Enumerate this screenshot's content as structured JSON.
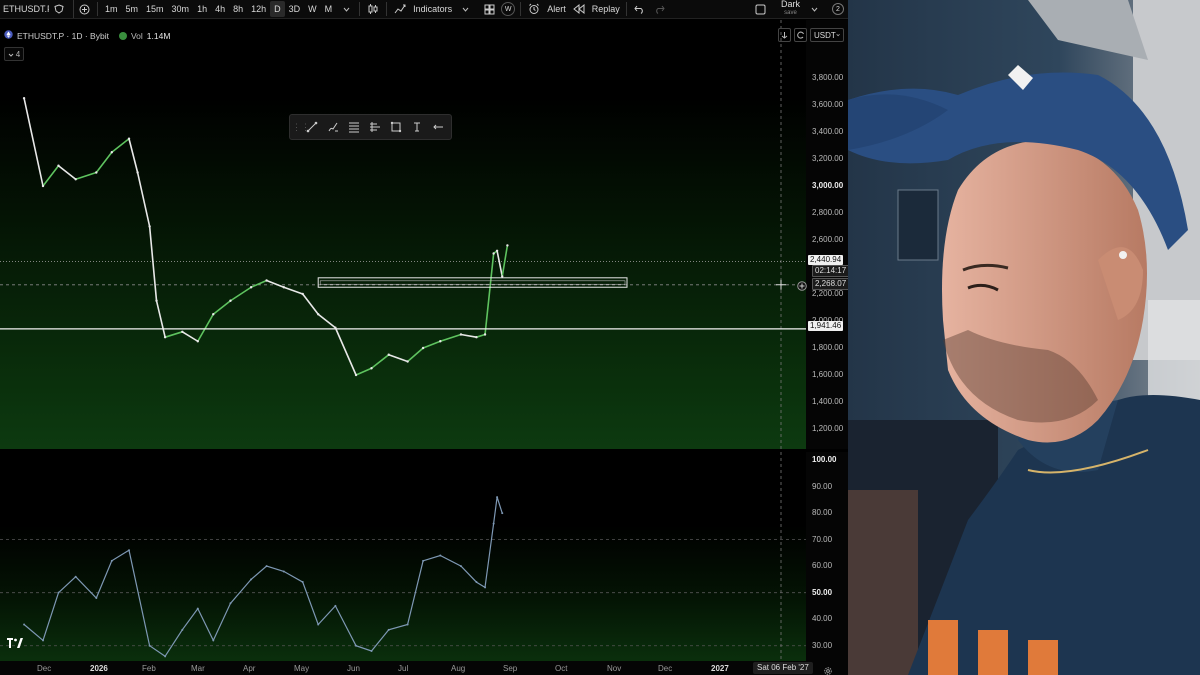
{
  "toolbar": {
    "symbol": "ETHUSDT.P",
    "timeframes": [
      {
        "label": "1m",
        "active": false
      },
      {
        "label": "5m",
        "active": false
      },
      {
        "label": "15m",
        "active": false
      },
      {
        "label": "30m",
        "active": false
      },
      {
        "label": "1h",
        "active": false
      },
      {
        "label": "4h",
        "active": false
      },
      {
        "label": "8h",
        "active": false
      },
      {
        "label": "12h",
        "active": false
      },
      {
        "label": "D",
        "active": true
      },
      {
        "label": "3D",
        "active": false
      },
      {
        "label": "W",
        "active": false
      },
      {
        "label": "M",
        "active": false
      }
    ],
    "indicators_label": "Indicators",
    "watchlist_badge": "W",
    "alert_label": "Alert",
    "replay_label": "Replay",
    "layout_name": "Dark",
    "layout_sub": "save",
    "layout_count": "2"
  },
  "legend": {
    "title": "ETHUSDT.P · 1D · Bybit",
    "vol_label": "Vol",
    "vol_value": "1.14M",
    "collapse_count": "4"
  },
  "currency": "USDT",
  "price_scale": [
    "3,800.00",
    "3,600.00",
    "3,400.00",
    "3,200.00",
    "3,000.00",
    "2,800.00",
    "2,600.00",
    "2,200.00",
    "2,000.00",
    "1,800.00",
    "1,600.00",
    "1,400.00",
    "1,200.00"
  ],
  "price_tags": {
    "last_price": "2,440.94",
    "countdown": "02:14:17",
    "cursor_price": "2,268.07",
    "level": "1,941.46"
  },
  "osc_scale": [
    "100.00",
    "90.00",
    "80.00",
    "70.00",
    "60.00",
    "50.00",
    "40.00",
    "30.00"
  ],
  "time_axis": [
    {
      "label": "Dec",
      "bold": false
    },
    {
      "label": "2026",
      "bold": true
    },
    {
      "label": "Feb",
      "bold": false
    },
    {
      "label": "Mar",
      "bold": false
    },
    {
      "label": "Apr",
      "bold": false
    },
    {
      "label": "May",
      "bold": false
    },
    {
      "label": "Jun",
      "bold": false
    },
    {
      "label": "Jul",
      "bold": false
    },
    {
      "label": "Aug",
      "bold": false
    },
    {
      "label": "Sep",
      "bold": false
    },
    {
      "label": "Oct",
      "bold": false
    },
    {
      "label": "Nov",
      "bold": false
    },
    {
      "label": "Dec",
      "bold": false
    },
    {
      "label": "2027",
      "bold": true
    }
  ],
  "cursor_date": "Sat 06 Feb '27",
  "colors": {
    "up": "#5ec35f",
    "down": "#e8e8e8",
    "osc_line": "#7e98b4",
    "zone": "#ffffff"
  },
  "chart_data": [
    {
      "type": "line",
      "description_series": "ETHUSDT.P daily price (approximate closes)",
      "x": [
        "2025-11-20",
        "2025-12-01",
        "2025-12-10",
        "2025-12-20",
        "2026-01-01",
        "2026-01-10",
        "2026-01-20",
        "2026-01-25",
        "2026-02-01",
        "2026-02-05",
        "2026-02-10",
        "2026-02-20",
        "2026-03-01",
        "2026-03-10",
        "2026-03-20",
        "2026-04-01",
        "2026-04-10",
        "2026-04-20",
        "2026-05-01",
        "2026-05-10",
        "2026-05-20",
        "2026-06-01",
        "2026-06-10",
        "2026-06-20",
        "2026-07-01",
        "2026-07-10",
        "2026-07-20",
        "2026-08-01",
        "2026-08-10",
        "2026-08-15",
        "2026-08-20",
        "2026-08-22",
        "2026-08-25",
        "2026-08-28"
      ],
      "y": [
        3650,
        3000,
        3150,
        3050,
        3100,
        3250,
        3350,
        3100,
        2700,
        2150,
        1880,
        1920,
        1850,
        2050,
        2150,
        2250,
        2300,
        2250,
        2200,
        2050,
        1950,
        1600,
        1650,
        1750,
        1700,
        1800,
        1850,
        1900,
        1880,
        1900,
        2500,
        2520,
        2330,
        2560
      ],
      "ylim": [
        1200,
        3800
      ],
      "ytick_labels": [
        "3,800.00",
        "3,600.00",
        "3,400.00",
        "3,200.00",
        "3,000.00",
        "2,800.00",
        "2,600.00",
        "2,200.00",
        "2,000.00",
        "1,800.00",
        "1,600.00",
        "1,400.00",
        "1,200.00"
      ],
      "horizontal_levels": [
        2440.94,
        1941.46
      ],
      "zone": [
        2250,
        2320
      ]
    },
    {
      "type": "line",
      "description_series": "Oscillator (approximate)",
      "x": [
        "2025-11-20",
        "2025-12-01",
        "2025-12-10",
        "2025-12-20",
        "2026-01-01",
        "2026-01-10",
        "2026-01-20",
        "2026-02-01",
        "2026-02-10",
        "2026-02-20",
        "2026-03-01",
        "2026-03-10",
        "2026-03-20",
        "2026-04-01",
        "2026-04-10",
        "2026-04-20",
        "2026-05-01",
        "2026-05-10",
        "2026-05-20",
        "2026-06-01",
        "2026-06-10",
        "2026-06-20",
        "2026-07-01",
        "2026-07-10",
        "2026-07-20",
        "2026-08-01",
        "2026-08-10",
        "2026-08-15",
        "2026-08-20",
        "2026-08-22",
        "2026-08-25"
      ],
      "y": [
        38,
        32,
        50,
        56,
        48,
        62,
        66,
        30,
        26,
        36,
        44,
        32,
        46,
        55,
        60,
        58,
        54,
        38,
        45,
        30,
        28,
        36,
        38,
        62,
        64,
        60,
        54,
        52,
        76,
        86,
        80
      ],
      "ylim": [
        25,
        100
      ],
      "levels": [
        70,
        50,
        30
      ]
    }
  ]
}
